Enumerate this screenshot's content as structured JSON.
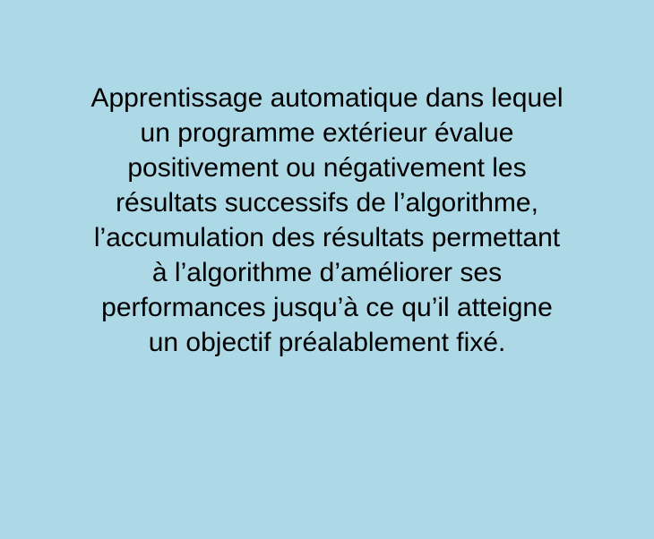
{
  "card": {
    "background_color": "#add8e6",
    "text_color": "#000000",
    "definition_lines": [
      "Apprentissage automatique dans lequel",
      "un programme extérieur évalue",
      "positivement ou négativement les",
      "résultats successifs de l’algorithme,",
      "l’accumulation des résultats permettant",
      "à l’algorithme d’améliorer ses",
      "performances jusqu’à ce qu’il atteigne",
      "un objectif préalablement fixé."
    ]
  }
}
